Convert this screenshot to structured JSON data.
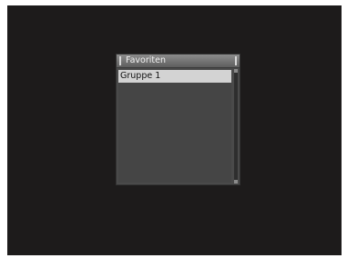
{
  "dialog": {
    "title": "Favoriten",
    "items": [
      {
        "label": "Gruppe 1",
        "selected": true
      }
    ]
  },
  "colors": {
    "screen_background": "#1d1b1b",
    "dialog_background": "#4a4a4a",
    "selected_item": "#d3d3d3"
  }
}
